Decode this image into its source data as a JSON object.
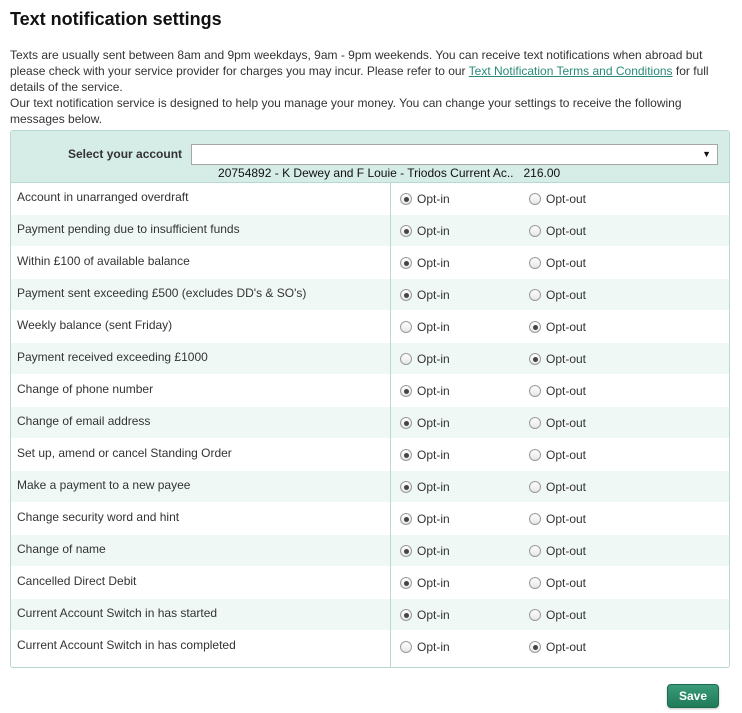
{
  "page": {
    "title": "Text notification settings",
    "intro_1": "Texts are usually sent between 8am and 9pm weekdays, 9am - 9pm weekends. You can receive text notifications when abroad but please check with your service provider for charges you may incur. Please refer to our ",
    "terms_link": "Text Notification Terms and Conditions",
    "intro_2": " for full details of the service.",
    "intro_3": "Our text notification service is designed to help you manage your money. You can change your settings to receive the following messages below."
  },
  "account": {
    "label": "Select your account",
    "selected": "20754892 - K Dewey and F Louie - Triodos Current Ac..   216.00",
    "arrow": "▼"
  },
  "options": {
    "in_label": "Opt-in",
    "out_label": "Opt-out"
  },
  "notifications": [
    {
      "label": "Account in unarranged overdraft",
      "choice": "in"
    },
    {
      "label": "Payment pending due to insufficient funds",
      "choice": "in"
    },
    {
      "label": "Within £100 of available balance",
      "choice": "in"
    },
    {
      "label": "Payment sent exceeding £500 (excludes DD's & SO's)",
      "choice": "in"
    },
    {
      "label": "Weekly balance (sent Friday)",
      "choice": "out"
    },
    {
      "label": "Payment received exceeding £1000",
      "choice": "out"
    },
    {
      "label": "Change of phone number",
      "choice": "in"
    },
    {
      "label": "Change of email address",
      "choice": "in"
    },
    {
      "label": "Set up, amend or cancel Standing Order",
      "choice": "in"
    },
    {
      "label": "Make a payment to a new payee",
      "choice": "in"
    },
    {
      "label": "Change security word and hint",
      "choice": "in"
    },
    {
      "label": "Change of name",
      "choice": "in"
    },
    {
      "label": "Cancelled Direct Debit",
      "choice": "in"
    },
    {
      "label": "Current Account Switch in has started",
      "choice": "in"
    },
    {
      "label": "Current Account Switch in has completed",
      "choice": "out"
    }
  ],
  "actions": {
    "save_label": "Save"
  },
  "colors": {
    "accent": "#2a8a77",
    "panel_header": "#d6ece7",
    "row_alt": "#f0f8f6",
    "button": "#2a8a66"
  }
}
